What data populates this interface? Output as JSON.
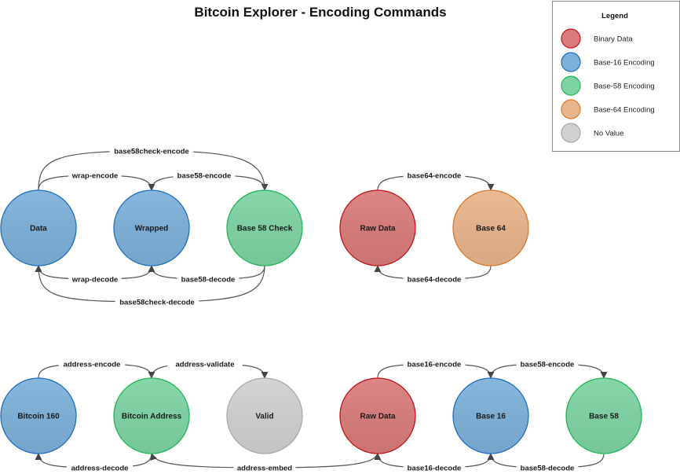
{
  "title": "Bitcoin Explorer - Encoding Commands",
  "legend": {
    "title": "Legend",
    "items": [
      {
        "key": "binary",
        "label": "Binary Data",
        "fill": "#d97b7b",
        "stroke": "#c0141c"
      },
      {
        "key": "base16",
        "label": "Base-16 Encoding",
        "fill": "#7db0d9",
        "stroke": "#1f6fbf"
      },
      {
        "key": "base58",
        "label": "Base-58 Encoding",
        "fill": "#7dd3a3",
        "stroke": "#22b35a"
      },
      {
        "key": "base64",
        "label": "Base-64 Encoding",
        "fill": "#e8b48b",
        "stroke": "#d9782a"
      },
      {
        "key": "none",
        "label": "No Value",
        "fill": "#d0d0d0",
        "stroke": "#a8a8a8"
      }
    ]
  },
  "nodes": [
    {
      "id": "data",
      "label": "Data",
      "type": "base16"
    },
    {
      "id": "wrapped",
      "label": "Wrapped",
      "type": "base16"
    },
    {
      "id": "b58check",
      "label": "Base 58 Check",
      "type": "base58"
    },
    {
      "id": "raw1",
      "label": "Raw Data",
      "type": "binary"
    },
    {
      "id": "b64",
      "label": "Base 64",
      "type": "base64"
    },
    {
      "id": "btc160",
      "label": "Bitcoin 160",
      "type": "base16"
    },
    {
      "id": "btcaddr",
      "label": "Bitcoin Address",
      "type": "base58"
    },
    {
      "id": "valid",
      "label": "Valid",
      "type": "none"
    },
    {
      "id": "raw2",
      "label": "Raw Data",
      "type": "binary"
    },
    {
      "id": "b16",
      "label": "Base 16",
      "type": "base16"
    },
    {
      "id": "b58",
      "label": "Base 58",
      "type": "base58"
    }
  ],
  "edges": [
    {
      "from": "data",
      "to": "b58check",
      "label": "base58check-encode"
    },
    {
      "from": "data",
      "to": "wrapped",
      "label": "wrap-encode"
    },
    {
      "from": "b58check",
      "to": "wrapped",
      "label": "base58-encode"
    },
    {
      "from": "wrapped",
      "to": "data",
      "label": "wrap-decode"
    },
    {
      "from": "b58check",
      "to": "wrapped",
      "label": "base58-decode"
    },
    {
      "from": "b58check",
      "to": "data",
      "label": "base58check-decode"
    },
    {
      "from": "raw1",
      "to": "b64",
      "label": "base64-encode"
    },
    {
      "from": "b64",
      "to": "raw1",
      "label": "base64-decode"
    },
    {
      "from": "btc160",
      "to": "btcaddr",
      "label": "address-encode"
    },
    {
      "from": "btcaddr",
      "to": "valid",
      "label": "address-validate"
    },
    {
      "from": "btcaddr",
      "to": "btc160",
      "label": "address-decode"
    },
    {
      "from": "raw2",
      "to": "btcaddr",
      "label": "address-embed"
    },
    {
      "from": "raw2",
      "to": "b16",
      "label": "base16-encode"
    },
    {
      "from": "b16",
      "to": "b58",
      "label": "base58-encode"
    },
    {
      "from": "b16",
      "to": "raw2",
      "label": "base16-decode"
    },
    {
      "from": "b58",
      "to": "b16",
      "label": "base58-decode"
    }
  ]
}
